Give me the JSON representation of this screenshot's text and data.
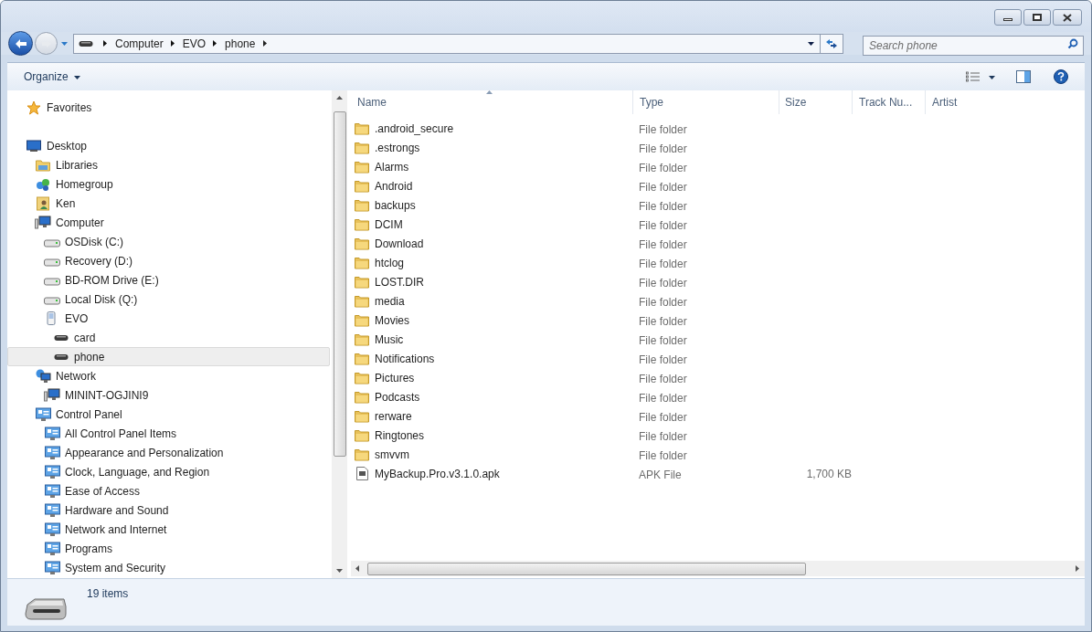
{
  "address_bar": {
    "crumbs": [
      "Computer",
      "EVO",
      "phone"
    ]
  },
  "search": {
    "placeholder": "Search phone"
  },
  "toolbar": {
    "organize": "Organize"
  },
  "navigation": {
    "favorites": {
      "label": "Favorites",
      "kind": "star",
      "selected": false
    },
    "tree": [
      {
        "label": "Desktop",
        "kind": "desktop",
        "selected": false,
        "children": [
          {
            "label": "Libraries",
            "kind": "library",
            "selected": false
          },
          {
            "label": "Homegroup",
            "kind": "homegroup",
            "selected": false
          },
          {
            "label": "Ken",
            "kind": "user",
            "selected": false
          },
          {
            "label": "Computer",
            "kind": "computer",
            "selected": false,
            "children": [
              {
                "label": "OSDisk (C:)",
                "kind": "disk",
                "selected": false
              },
              {
                "label": "Recovery (D:)",
                "kind": "disk",
                "selected": false
              },
              {
                "label": "BD-ROM Drive (E:)",
                "kind": "disk",
                "selected": false
              },
              {
                "label": "Local Disk (Q:)",
                "kind": "disk",
                "selected": false
              },
              {
                "label": "EVO",
                "kind": "device",
                "selected": false,
                "children": [
                  {
                    "label": "card",
                    "kind": "storage",
                    "selected": false
                  },
                  {
                    "label": "phone",
                    "kind": "storage",
                    "selected": true
                  }
                ]
              }
            ]
          },
          {
            "label": "Network",
            "kind": "network",
            "selected": false,
            "children": [
              {
                "label": "MININT-OGJINI9",
                "kind": "computer",
                "selected": false
              }
            ]
          },
          {
            "label": "Control Panel",
            "kind": "control",
            "selected": false,
            "children": [
              {
                "label": "All Control Panel Items",
                "kind": "control",
                "selected": false
              },
              {
                "label": "Appearance and Personalization",
                "kind": "control",
                "selected": false
              },
              {
                "label": "Clock, Language, and Region",
                "kind": "control",
                "selected": false
              },
              {
                "label": "Ease of Access",
                "kind": "control",
                "selected": false
              },
              {
                "label": "Hardware and Sound",
                "kind": "control",
                "selected": false
              },
              {
                "label": "Network and Internet",
                "kind": "control",
                "selected": false
              },
              {
                "label": "Programs",
                "kind": "control",
                "selected": false
              },
              {
                "label": "System and Security",
                "kind": "control",
                "selected": false
              }
            ]
          }
        ]
      }
    ]
  },
  "table": {
    "columns": [
      "Name",
      "Type",
      "Size",
      "Track Nu...",
      "Artist"
    ],
    "rows": [
      {
        "kind": "folder",
        "name": ".android_secure",
        "type": "File folder"
      },
      {
        "kind": "folder",
        "name": ".estrongs",
        "type": "File folder"
      },
      {
        "kind": "folder",
        "name": "Alarms",
        "type": "File folder"
      },
      {
        "kind": "folder",
        "name": "Android",
        "type": "File folder"
      },
      {
        "kind": "folder",
        "name": "backups",
        "type": "File folder"
      },
      {
        "kind": "folder",
        "name": "DCIM",
        "type": "File folder"
      },
      {
        "kind": "folder",
        "name": "Download",
        "type": "File folder"
      },
      {
        "kind": "folder",
        "name": "htclog",
        "type": "File folder"
      },
      {
        "kind": "folder",
        "name": "LOST.DIR",
        "type": "File folder"
      },
      {
        "kind": "folder",
        "name": "media",
        "type": "File folder"
      },
      {
        "kind": "folder",
        "name": "Movies",
        "type": "File folder"
      },
      {
        "kind": "folder",
        "name": "Music",
        "type": "File folder"
      },
      {
        "kind": "folder",
        "name": "Notifications",
        "type": "File folder"
      },
      {
        "kind": "folder",
        "name": "Pictures",
        "type": "File folder"
      },
      {
        "kind": "folder",
        "name": "Podcasts",
        "type": "File folder"
      },
      {
        "kind": "folder",
        "name": "rerware",
        "type": "File folder"
      },
      {
        "kind": "folder",
        "name": "Ringtones",
        "type": "File folder"
      },
      {
        "kind": "folder",
        "name": "smvvm",
        "type": "File folder"
      },
      {
        "kind": "file",
        "name": "MyBackup.Pro.v3.1.0.apk",
        "type": "APK File",
        "size": "1,700 KB"
      }
    ]
  },
  "status_bar": {
    "count": "19 items"
  }
}
